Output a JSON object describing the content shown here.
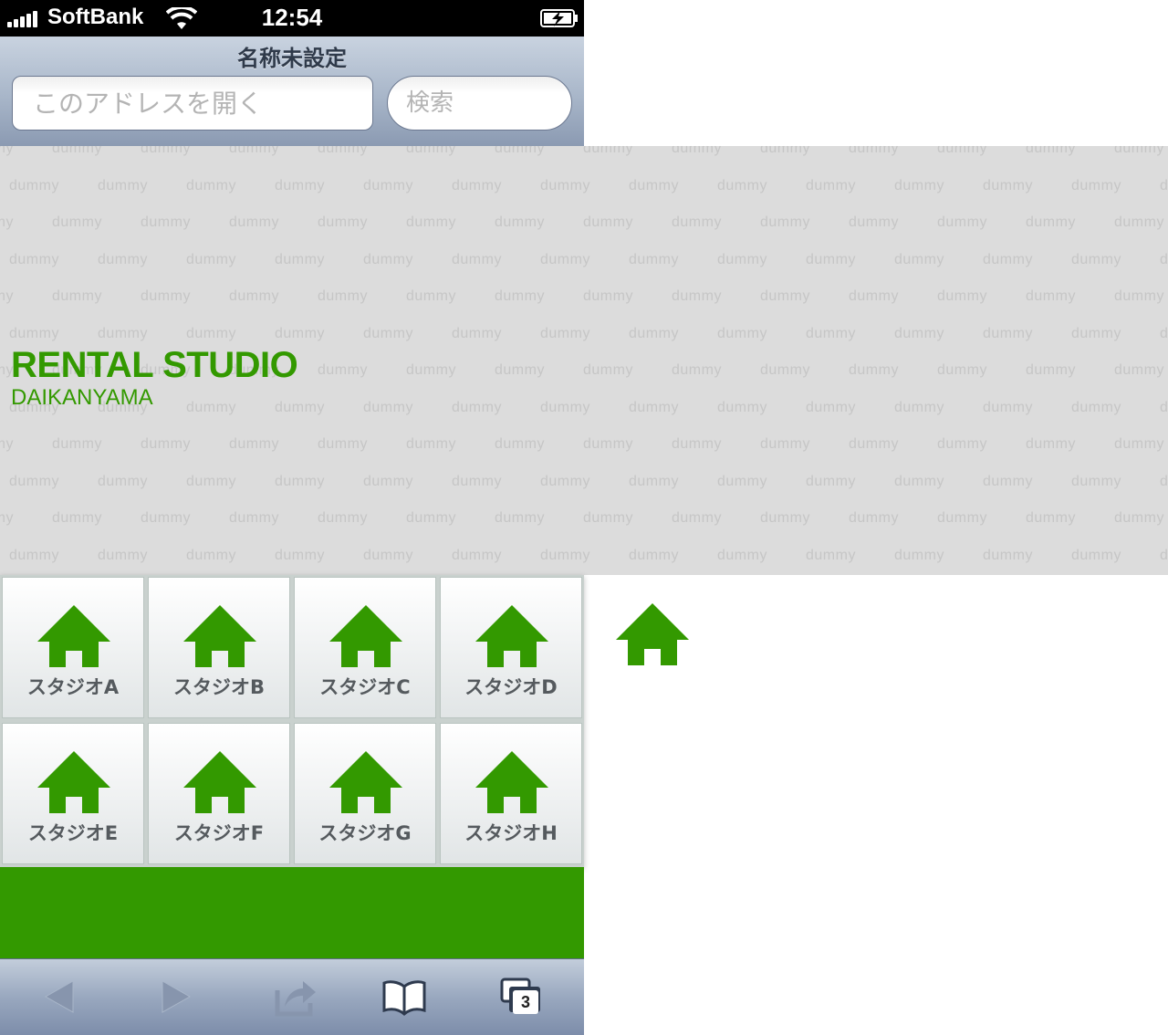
{
  "status_bar": {
    "carrier": "SoftBank",
    "time": "12:54",
    "icons": [
      "signal-icon",
      "wifi-icon",
      "battery-charging-icon"
    ]
  },
  "address_bar": {
    "page_title": "名称未設定",
    "url_placeholder": "このアドレスを開く",
    "search_placeholder": "検索"
  },
  "hero": {
    "background_word": "dummy",
    "title": "RENTAL STUDIO",
    "subtitle": "DAIKANYAMA",
    "brand_color": "#339900",
    "background_color": "#dcdcdc"
  },
  "studios": [
    {
      "label": "スタジオA",
      "icon": "house-icon"
    },
    {
      "label": "スタジオB",
      "icon": "house-icon"
    },
    {
      "label": "スタジオC",
      "icon": "house-icon"
    },
    {
      "label": "スタジオD",
      "icon": "house-icon"
    },
    {
      "label": "スタジオE",
      "icon": "house-icon"
    },
    {
      "label": "スタジオF",
      "icon": "house-icon"
    },
    {
      "label": "スタジオG",
      "icon": "house-icon"
    },
    {
      "label": "スタジオH",
      "icon": "house-icon"
    }
  ],
  "toolbar": {
    "buttons": [
      "back-icon",
      "forward-icon",
      "share-icon",
      "bookmarks-icon",
      "tabs-icon"
    ],
    "tab_count": "3"
  }
}
